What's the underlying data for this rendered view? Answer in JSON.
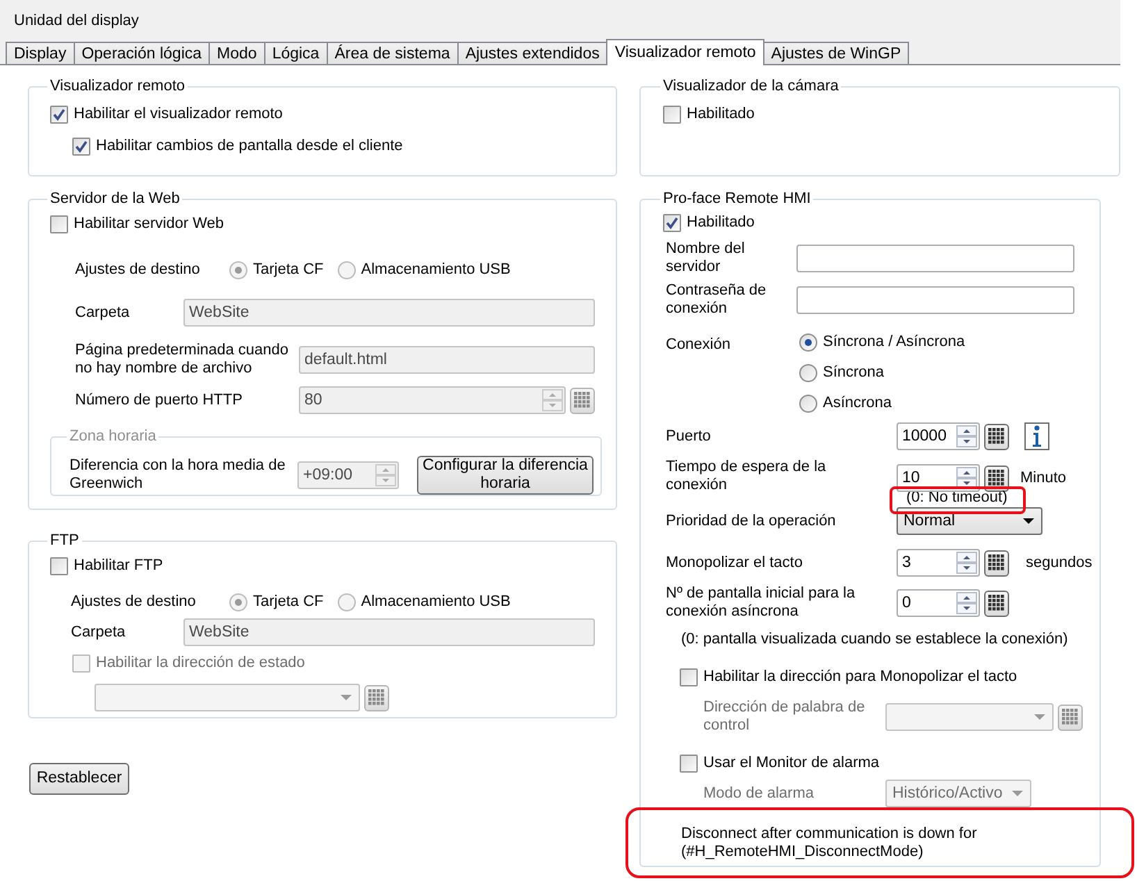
{
  "window": {
    "title": "Unidad del display"
  },
  "tabs": [
    {
      "label": "Display",
      "selected": false
    },
    {
      "label": "Operación lógica",
      "selected": false
    },
    {
      "label": "Modo",
      "selected": false
    },
    {
      "label": "Lógica",
      "selected": false
    },
    {
      "label": "Área de sistema",
      "selected": false
    },
    {
      "label": "Ajustes extendidos",
      "selected": false
    },
    {
      "label": "Visualizador remoto",
      "selected": true
    },
    {
      "label": "Ajustes de WinGP",
      "selected": false
    }
  ],
  "remote_viewer": {
    "title": "Visualizador remoto",
    "enable": {
      "label": "Habilitar el visualizador remoto",
      "checked": true
    },
    "screen_change": {
      "label": "Habilitar cambios de pantalla desde el cliente",
      "checked": true
    }
  },
  "web_server": {
    "title": "Servidor de la Web",
    "enable": {
      "label": "Habilitar servidor Web",
      "checked": false
    },
    "destination": {
      "label": "Ajustes de destino",
      "options": [
        {
          "label": "Tarjeta CF",
          "selected": true
        },
        {
          "label": "Almacenamiento USB",
          "selected": false
        }
      ]
    },
    "folder": {
      "label": "Carpeta",
      "value": "WebSite"
    },
    "default_page": {
      "label": "Página predeterminada cuando no hay nombre de archivo",
      "value": "default.html"
    },
    "http_port": {
      "label": "Número de puerto HTTP",
      "value": "80"
    },
    "timezone": {
      "title": "Zona horaria",
      "gmt_offset": {
        "label": "Diferencia con la hora media de Greenwich",
        "value": "+09:00"
      },
      "button": "Configurar la diferencia horaria"
    }
  },
  "ftp": {
    "title": "FTP",
    "enable": {
      "label": "Habilitar FTP",
      "checked": false
    },
    "destination": {
      "label": "Ajustes de destino",
      "options": [
        {
          "label": "Tarjeta CF",
          "selected": true
        },
        {
          "label": "Almacenamiento USB",
          "selected": false
        }
      ]
    },
    "folder": {
      "label": "Carpeta",
      "value": "WebSite"
    },
    "status_address": {
      "label": "Habilitar la dirección de estado",
      "checked": false
    }
  },
  "reset_button": "Restablecer",
  "camera_viewer": {
    "title": "Visualizador de la cámara",
    "enable": {
      "label": "Habilitado",
      "checked": false
    }
  },
  "remote_hmi": {
    "title": "Pro-face Remote HMI",
    "enable": {
      "label": "Habilitado",
      "checked": true
    },
    "server_name": {
      "label": "Nombre del servidor"
    },
    "password": {
      "label": "Contraseña de conexión"
    },
    "connection": {
      "label": "Conexión",
      "options": [
        {
          "label": "Síncrona / Asíncrona",
          "selected": true
        },
        {
          "label": "Síncrona",
          "selected": false
        },
        {
          "label": "Asíncrona",
          "selected": false
        }
      ]
    },
    "port": {
      "label": "Puerto",
      "value": "10000"
    },
    "timeout": {
      "label": "Tiempo de espera de la conexión",
      "value": "10",
      "unit": "Minuto",
      "note": "(0: No timeout)"
    },
    "priority": {
      "label": "Prioridad de la operación",
      "value": "Normal"
    },
    "touch": {
      "label": "Monopolizar el tacto",
      "value": "3",
      "unit": "segundos"
    },
    "initial_screen": {
      "label": "Nº de pantalla inicial para la conexión asíncrona",
      "value": "0",
      "note": "(0: pantalla visualizada cuando se establece la conexión)"
    },
    "touch_address": {
      "label": "Habilitar la dirección para Monopolizar el tacto",
      "checked": false
    },
    "control_word": {
      "label": "Dirección de palabra de control"
    },
    "alarm_monitor": {
      "label": "Usar el Monitor de alarma",
      "checked": false
    },
    "alarm_mode": {
      "label": "Modo de alarma",
      "value": "Histórico/Activo"
    },
    "disconnect_note": "Disconnect after communication is down for (#H_RemoteHMI_DisconnectMode)"
  }
}
